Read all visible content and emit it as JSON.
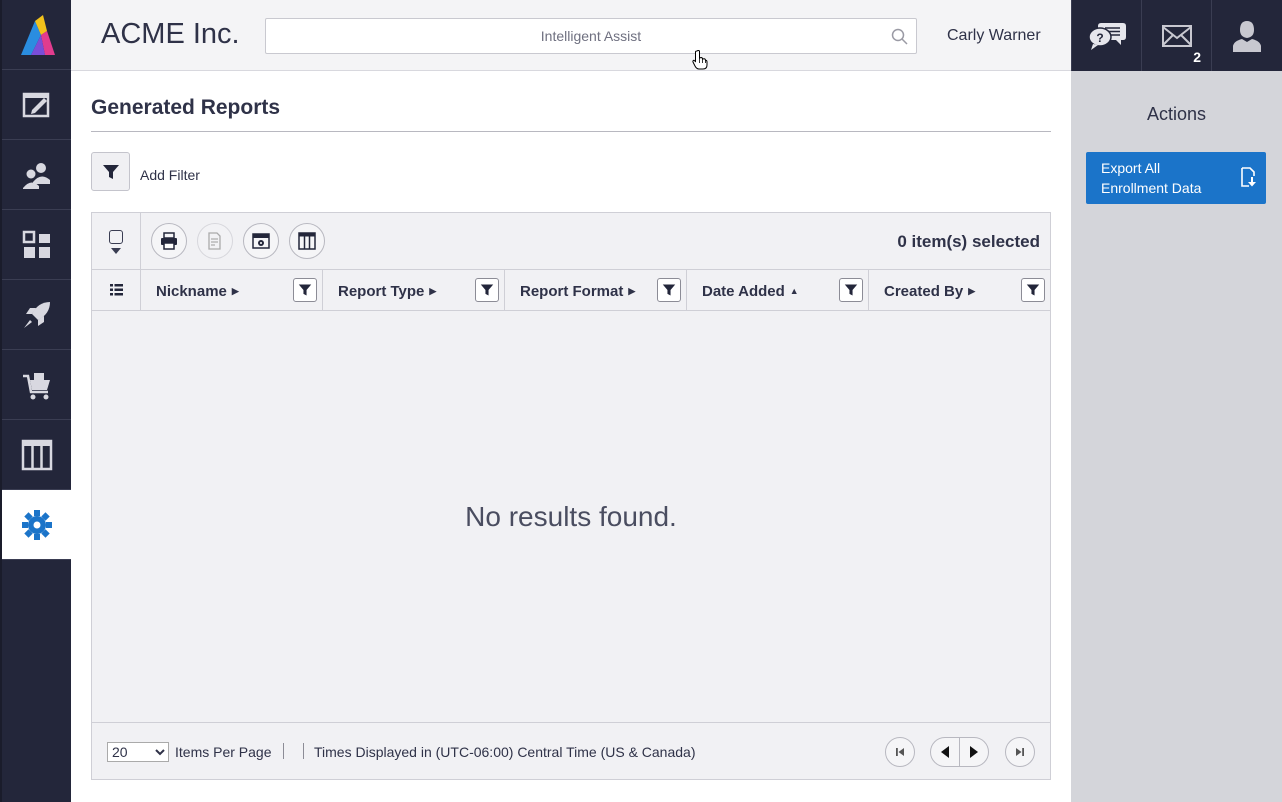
{
  "header": {
    "company": "ACME Inc.",
    "search_placeholder": "Intelligent Assist",
    "user_name": "Carly Warner"
  },
  "topbar": {
    "icons": [
      "help-chat-icon",
      "mail-icon",
      "user-profile-icon"
    ],
    "mail_badge": "2"
  },
  "sidebar": {
    "items": [
      {
        "icon": "edit-icon",
        "active": false
      },
      {
        "icon": "users-icon",
        "active": false
      },
      {
        "icon": "dashboard-icon",
        "active": false
      },
      {
        "icon": "rocket-icon",
        "active": false
      },
      {
        "icon": "cart-icon",
        "active": false
      },
      {
        "icon": "columns-icon",
        "active": false
      },
      {
        "icon": "gear-icon",
        "active": true
      }
    ]
  },
  "page": {
    "title": "Generated Reports",
    "add_filter": "Add Filter"
  },
  "grid": {
    "selected_count": "0 item(s) selected",
    "columns": [
      {
        "label": "Nickname",
        "sort": "none"
      },
      {
        "label": "Report Type",
        "sort": "none"
      },
      {
        "label": "Report Format",
        "sort": "none"
      },
      {
        "label": "Date Added",
        "sort": "ascending"
      },
      {
        "label": "Created By",
        "sort": "none"
      }
    ],
    "empty_message": "No results found."
  },
  "footer": {
    "per_page_value": "20",
    "per_page_options": [
      "20"
    ],
    "per_page_label": "Items Per Page",
    "timezone": "Times Displayed in (UTC-06:00) Central Time (US & Canada)"
  },
  "actions": {
    "title": "Actions",
    "export_label_line1": "Export All",
    "export_label_line2": "Enrollment Data"
  },
  "colors": {
    "nav_bg": "#23263a",
    "accent": "#1b74c9",
    "panel_bg": "#d4d5da"
  }
}
